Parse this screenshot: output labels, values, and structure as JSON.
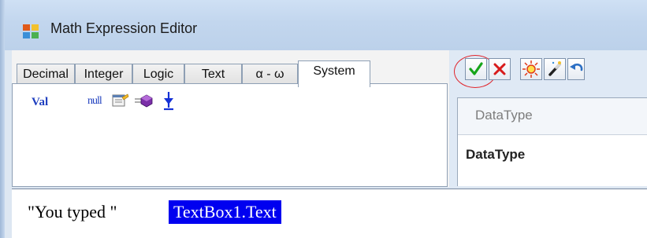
{
  "window": {
    "title": "Math Expression Editor",
    "icon": "app-window-icon"
  },
  "tabs": [
    {
      "label": "Decimal"
    },
    {
      "label": "Integer"
    },
    {
      "label": "Logic"
    },
    {
      "label": "Text"
    },
    {
      "label": "α - ω"
    },
    {
      "label": "System",
      "active": true
    }
  ],
  "system_tab": {
    "val_label": "Val",
    "null_label": "null",
    "icons": [
      "properties-icon",
      "method-icon",
      "arrow-down-icon"
    ]
  },
  "toolbar": {
    "buttons": [
      "ok-check-icon",
      "cancel-x-icon",
      "sun-icon",
      "magic-wand-icon",
      "undo-icon"
    ],
    "colors": {
      "check": "#17a51a",
      "cancel": "#d81b1b",
      "highlight_circle": "#e0242b"
    }
  },
  "grid": {
    "header": "DataType",
    "row_value": "DataType"
  },
  "expression": {
    "literal": "\"You typed \"",
    "selected": "TextBox1.Text",
    "selection_color": "#0000f0"
  }
}
